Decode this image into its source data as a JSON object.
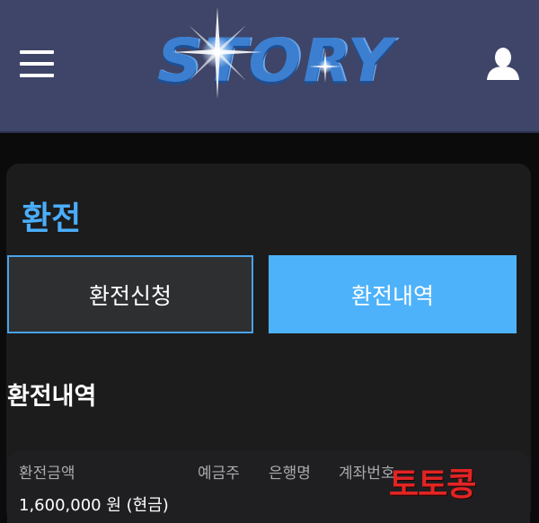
{
  "header": {
    "logo_text": "STORY",
    "menu_icon": "hamburger-menu-icon",
    "user_icon": "user-icon",
    "background": "#3f4568"
  },
  "page": {
    "title": "환전"
  },
  "tabs": [
    {
      "label": "환전신청",
      "active": false
    },
    {
      "label": "환전내역",
      "active": true
    }
  ],
  "history": {
    "section_title": "환전내역",
    "columns": [
      "환전금액",
      "예금주",
      "은행명",
      "계좌번호"
    ],
    "rows": [
      {
        "amount": "1,600,000 원 (현금)"
      }
    ]
  },
  "watermark": "토토콩",
  "colors": {
    "accent": "#4aaefc",
    "active_tab": "#4eb2fb",
    "watermark": "#e32424"
  }
}
